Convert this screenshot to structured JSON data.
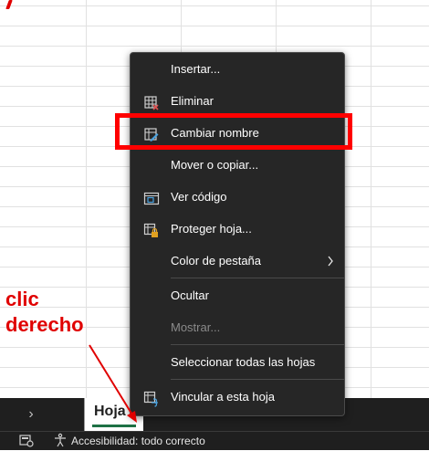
{
  "menu": {
    "items": [
      {
        "label": "Insertar...",
        "icon": "none"
      },
      {
        "label": "Eliminar",
        "icon": "delete-sheet-icon"
      },
      {
        "label": "Cambiar nombre",
        "icon": "rename-icon"
      },
      {
        "label": "Mover o copiar...",
        "icon": "none"
      },
      {
        "label": "Ver código",
        "icon": "view-code-icon"
      },
      {
        "label": "Proteger hoja...",
        "icon": "protect-sheet-icon"
      },
      {
        "label": "Color de pestaña",
        "icon": "none"
      },
      {
        "label": "Ocultar",
        "icon": "none"
      },
      {
        "label": "Mostrar...",
        "icon": "none",
        "disabled": true
      },
      {
        "label": "Seleccionar todas las hojas",
        "icon": "none"
      },
      {
        "label": "Vincular a esta hoja",
        "icon": "link-sheet-icon"
      }
    ]
  },
  "sheetbar": {
    "nav_arrow": "›",
    "tab_label": "Hoja",
    "add_symbol": "+"
  },
  "statusbar": {
    "accessibility_text": "Accesibilidad: todo correcto"
  },
  "annotation": {
    "line1": "clic",
    "line2": "derecho"
  },
  "colors": {
    "menu_bg": "#262626",
    "highlight": "#ff0000",
    "annotation": "#e00000",
    "tab_underline": "#1e7145"
  }
}
